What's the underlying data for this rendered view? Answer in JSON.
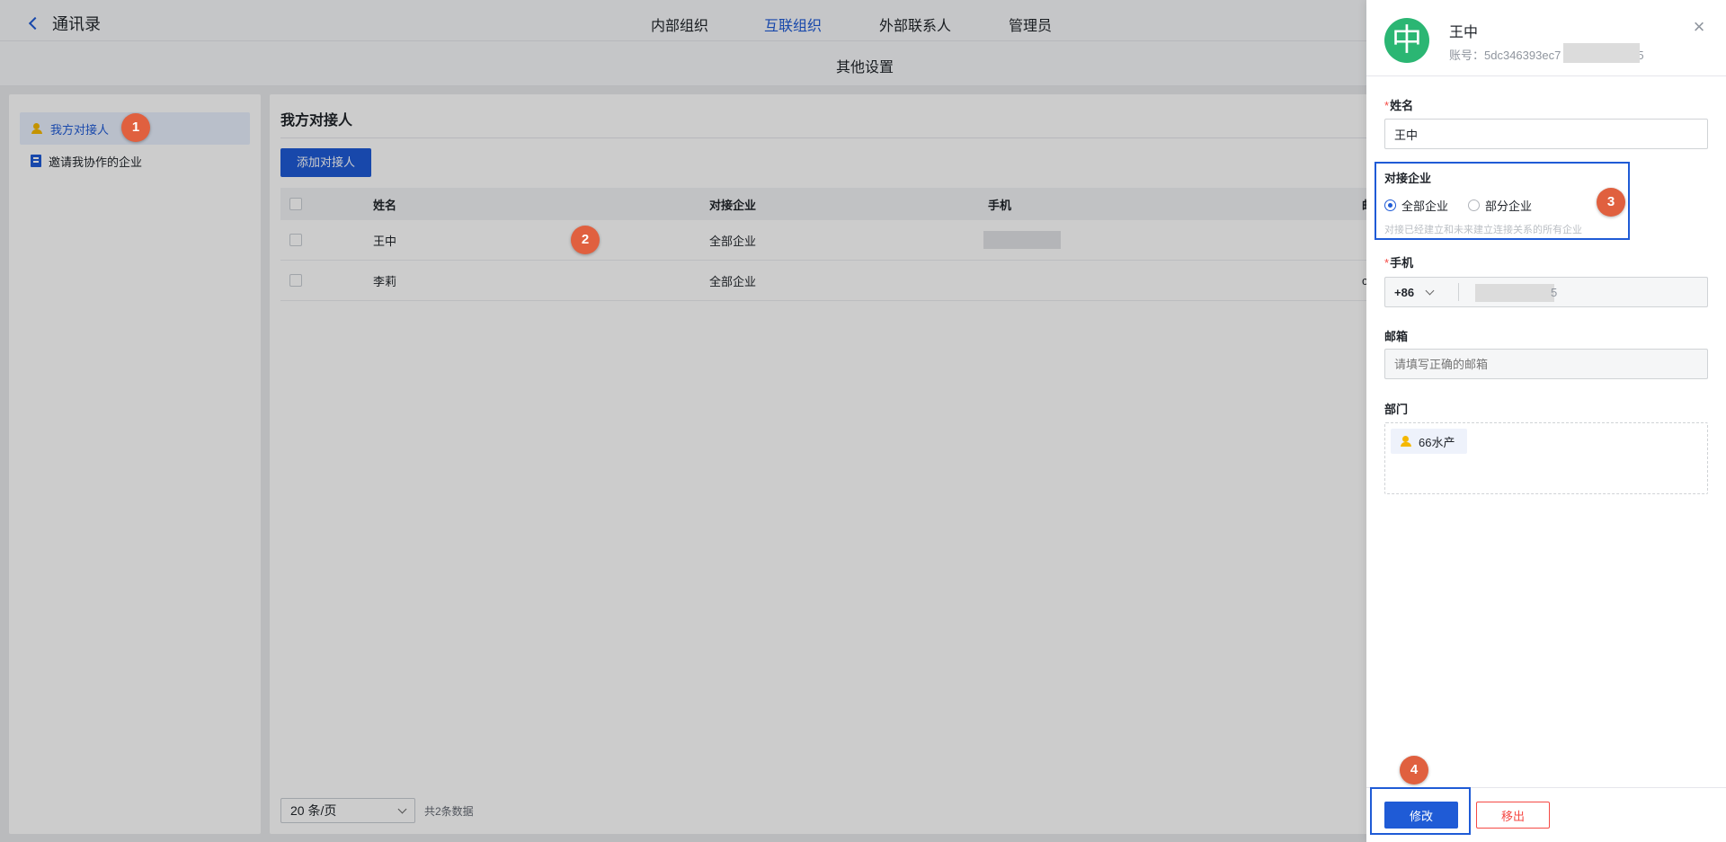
{
  "topbar": {
    "back_label": "通讯录",
    "tabs": [
      "内部组织",
      "互联组织",
      "外部联系人",
      "管理员"
    ],
    "active_tab": "互联组织"
  },
  "subheader": {
    "title": "其他设置"
  },
  "sidebar": {
    "items": [
      {
        "label": "我方对接人",
        "icon": "user-icon",
        "active": true
      },
      {
        "label": "邀请我协作的企业",
        "icon": "building-icon",
        "active": false
      }
    ]
  },
  "main": {
    "title": "我方对接人",
    "add_button": "添加对接人",
    "columns": [
      "姓名",
      "对接企业",
      "手机",
      "邮"
    ],
    "rows": [
      {
        "name": "王中",
        "enterprise": "全部企业",
        "extra": ""
      },
      {
        "name": "李莉",
        "enterprise": "全部企业",
        "extra": "c"
      }
    ],
    "pager": {
      "page_size": "20 条/页",
      "total": "共2条数据"
    }
  },
  "drawer": {
    "avatar_char": "中",
    "name": "王中",
    "account": "账号：5dc346393ec7",
    "account_tail": "5",
    "close_icon": "close-icon",
    "fields": {
      "name_label": "姓名",
      "name_value": "王中",
      "enterprise_label": "对接企业",
      "radio_all": "全部企业",
      "radio_partial": "部分企业",
      "enterprise_hint": "对接已经建立和未来建立连接关系的所有企业",
      "phone_label": "手机",
      "country_code": "+86",
      "phone_tail": "5",
      "email_label": "邮箱",
      "email_placeholder": "请填写正确的邮箱",
      "dept_label": "部门",
      "dept_tag": "66水产"
    },
    "buttons": {
      "edit": "修改",
      "remove": "移出"
    }
  },
  "annotations": [
    "1",
    "2",
    "3",
    "4"
  ],
  "colors": {
    "accent": "#1f5bd6",
    "badge": "#e0603f",
    "avatar": "#2bb673",
    "danger": "#f54a45"
  }
}
